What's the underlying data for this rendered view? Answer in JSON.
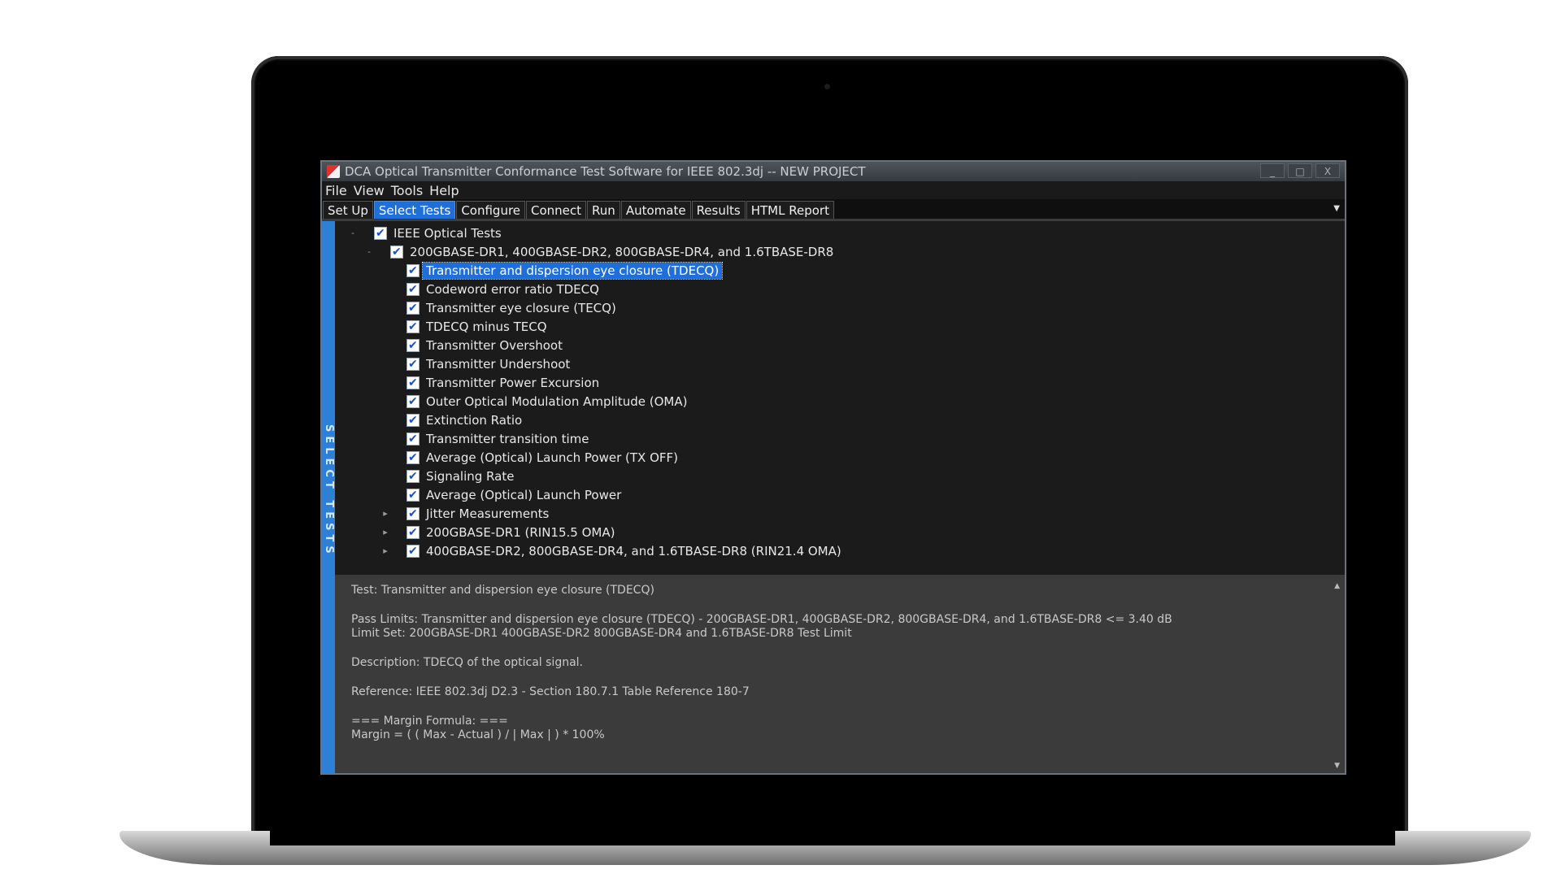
{
  "window": {
    "title": "DCA Optical Transmitter Conformance Test Software for IEEE 802.3dj -- NEW PROJECT",
    "minimize": "_",
    "maximize": "□",
    "close": "X"
  },
  "menu": [
    "File",
    "View",
    "Tools",
    "Help"
  ],
  "tabs": [
    {
      "label": "Set Up",
      "active": false
    },
    {
      "label": "Select Tests",
      "active": true
    },
    {
      "label": "Configure",
      "active": false
    },
    {
      "label": "Connect",
      "active": false
    },
    {
      "label": "Run",
      "active": false
    },
    {
      "label": "Automate",
      "active": false
    },
    {
      "label": "Results",
      "active": false
    },
    {
      "label": "HTML Report",
      "active": false
    }
  ],
  "side_label": "SELECT TESTS",
  "tree": [
    {
      "label": "IEEE Optical Tests",
      "level": 0,
      "checked": true,
      "expander": "-"
    },
    {
      "label": "200GBASE-DR1, 400GBASE-DR2, 800GBASE-DR4, and 1.6TBASE-DR8",
      "level": 1,
      "checked": true,
      "expander": "-"
    },
    {
      "label": "Transmitter and dispersion eye closure (TDECQ)",
      "level": 2,
      "checked": true,
      "selected": true
    },
    {
      "label": "Codeword error ratio TDECQ",
      "level": 2,
      "checked": true
    },
    {
      "label": "Transmitter eye closure (TECQ)",
      "level": 2,
      "checked": true
    },
    {
      "label": "TDECQ minus TECQ",
      "level": 2,
      "checked": true
    },
    {
      "label": "Transmitter Overshoot",
      "level": 2,
      "checked": true
    },
    {
      "label": "Transmitter Undershoot",
      "level": 2,
      "checked": true
    },
    {
      "label": "Transmitter Power Excursion",
      "level": 2,
      "checked": true
    },
    {
      "label": "Outer Optical Modulation Amplitude (OMA)",
      "level": 2,
      "checked": true
    },
    {
      "label": "Extinction Ratio",
      "level": 2,
      "checked": true
    },
    {
      "label": "Transmitter transition time",
      "level": 2,
      "checked": true
    },
    {
      "label": "Average (Optical) Launch Power (TX OFF)",
      "level": 2,
      "checked": true
    },
    {
      "label": "Signaling Rate",
      "level": 2,
      "checked": true
    },
    {
      "label": "Average (Optical) Launch Power",
      "level": 2,
      "checked": true
    },
    {
      "label": "Jitter Measurements",
      "level": 2,
      "checked": true,
      "expander": "▸"
    },
    {
      "label": "200GBASE-DR1 (RIN15.5 OMA)",
      "level": 2,
      "checked": true,
      "expander": "▸"
    },
    {
      "label": "400GBASE-DR2, 800GBASE-DR4, and 1.6TBASE-DR8 (RIN21.4 OMA)",
      "level": 2,
      "checked": true,
      "expander": "▸"
    }
  ],
  "details": {
    "test": "Test: Transmitter and dispersion eye closure (TDECQ)",
    "pass_limits": "Pass Limits: Transmitter and dispersion eye closure (TDECQ) - 200GBASE-DR1, 400GBASE-DR2, 800GBASE-DR4, and 1.6TBASE-DR8 <= 3.40 dB",
    "limit_set": "Limit Set: 200GBASE-DR1 400GBASE-DR2 800GBASE-DR4 and 1.6TBASE-DR8 Test Limit",
    "description": "Description: TDECQ of the optical signal.",
    "reference": "Reference: IEEE 802.3dj D2.3 - Section 180.7.1 Table Reference 180-7",
    "margin_header": "=== Margin Formula: ===",
    "margin_formula": "Margin = ( ( Max - Actual ) / | Max | ) * 100%"
  }
}
